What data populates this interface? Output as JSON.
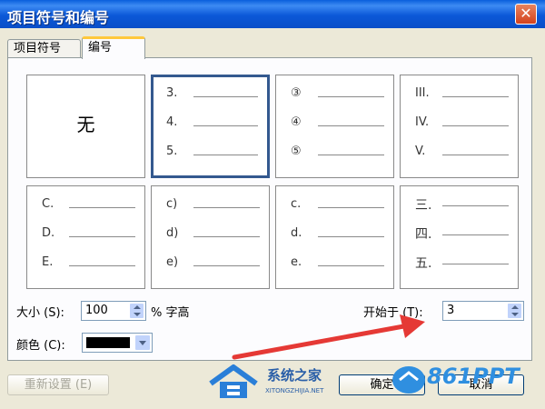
{
  "dialog": {
    "title": "项目符号和编号",
    "close_glyph": "✕"
  },
  "tabs": [
    {
      "label": "项目符号"
    },
    {
      "label": "编号"
    }
  ],
  "styles": {
    "none_label": "无",
    "cells": [
      {
        "marks": []
      },
      {
        "marks": [
          "3.",
          "4.",
          "5."
        ]
      },
      {
        "marks": [
          "③",
          "④",
          "⑤"
        ]
      },
      {
        "marks": [
          "III.",
          "IV.",
          "V."
        ]
      },
      {
        "marks": [
          "C.",
          "D.",
          "E."
        ]
      },
      {
        "marks": [
          "c)",
          "d)",
          "e)"
        ]
      },
      {
        "marks": [
          "c.",
          "d.",
          "e."
        ]
      },
      {
        "marks": [
          "三.",
          "四.",
          "五."
        ]
      }
    ]
  },
  "size": {
    "label": "大小 (S):",
    "value": "100",
    "unit": "% 字高"
  },
  "color": {
    "label": "颜色 (C):",
    "value": "#000000"
  },
  "start_at": {
    "label": "开始于 (T):",
    "value": "3"
  },
  "buttons": {
    "reset": "重新设置 (E)",
    "ok": "确定",
    "cancel": "取消"
  },
  "watermarks": {
    "site1": "系统之家",
    "site1_url": "XITONGZHIJIA.NET",
    "site2": "861PPT"
  },
  "colors": {
    "title_bar": "#0b58d8",
    "selection_border": "#34598f",
    "arrow": "#e53935"
  }
}
